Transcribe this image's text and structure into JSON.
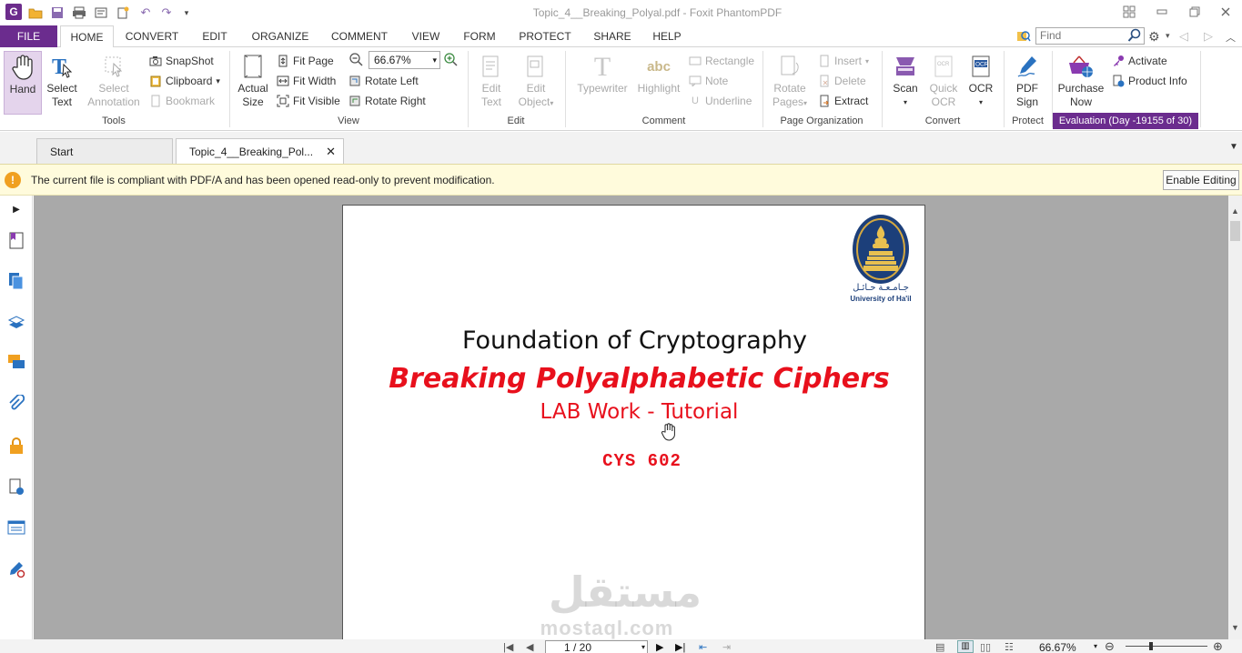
{
  "window": {
    "title": "Topic_4__Breaking_Polyal.pdf - Foxit PhantomPDF",
    "app_logo": "G"
  },
  "menu": {
    "tabs": [
      "FILE",
      "HOME",
      "CONVERT",
      "EDIT",
      "ORGANIZE",
      "COMMENT",
      "VIEW",
      "FORM",
      "PROTECT",
      "SHARE",
      "HELP"
    ],
    "find_placeholder": "Find"
  },
  "ribbon": {
    "tools": {
      "hand": "Hand",
      "select_text": [
        "Select",
        "Text"
      ],
      "select_annotation": [
        "Select",
        "Annotation"
      ],
      "snapshot": "SnapShot",
      "clipboard": "Clipboard",
      "bookmark": "Bookmark",
      "group_label": "Tools"
    },
    "view": {
      "actual_size": [
        "Actual",
        "Size"
      ],
      "fit_page": "Fit Page",
      "fit_width": "Fit Width",
      "fit_visible": "Fit Visible",
      "zoom_value": "66.67%",
      "rotate_left": "Rotate Left",
      "rotate_right": "Rotate Right",
      "group_label": "View"
    },
    "edit": {
      "edit_text": [
        "Edit",
        "Text"
      ],
      "edit_object": [
        "Edit",
        "Object"
      ],
      "group_label": "Edit"
    },
    "comment": {
      "typewriter": "Typewriter",
      "highlight": "Highlight",
      "rectangle": "Rectangle",
      "note": "Note",
      "underline": "Underline",
      "group_label": "Comment"
    },
    "page_org": {
      "rotate_pages": [
        "Rotate",
        "Pages"
      ],
      "insert": "Insert",
      "delete": "Delete",
      "extract": "Extract",
      "group_label": "Page Organization"
    },
    "convert": {
      "scan": "Scan",
      "quick_ocr": [
        "Quick",
        "OCR"
      ],
      "ocr": "OCR",
      "group_label": "Convert"
    },
    "protect": {
      "pdf_sign": [
        "PDF",
        "Sign"
      ],
      "group_label": "Protect"
    },
    "eval": {
      "purchase_now": [
        "Purchase",
        "Now"
      ],
      "activate": "Activate",
      "product_info": "Product Info",
      "evaluation_text": "Evaluation (Day -19155 of 30)"
    }
  },
  "doc_tabs": {
    "start": "Start",
    "current": "Topic_4__Breaking_Pol..."
  },
  "notice": {
    "message": "The current file is compliant with PDF/A and has been opened read-only to prevent modification.",
    "enable_editing": "Enable Editing"
  },
  "page": {
    "university_arabic": "جـامـعـة حـائـل",
    "university_english": "University of Ha'il",
    "title": "Foundation of Cryptography",
    "subtitle": "Breaking Polyalphabetic Ciphers",
    "lab": "LAB Work - Tutorial",
    "code": "CYS 602",
    "watermark_ar": "مستقل",
    "watermark_en": "mostaql.com"
  },
  "status": {
    "page_indicator": "1 / 20",
    "zoom": "66.67%"
  },
  "colors": {
    "brand": "#6b2c8e",
    "title_red": "#e8101c",
    "notice_bg": "#fffbdc",
    "doc_bg": "#a9a9a9"
  }
}
